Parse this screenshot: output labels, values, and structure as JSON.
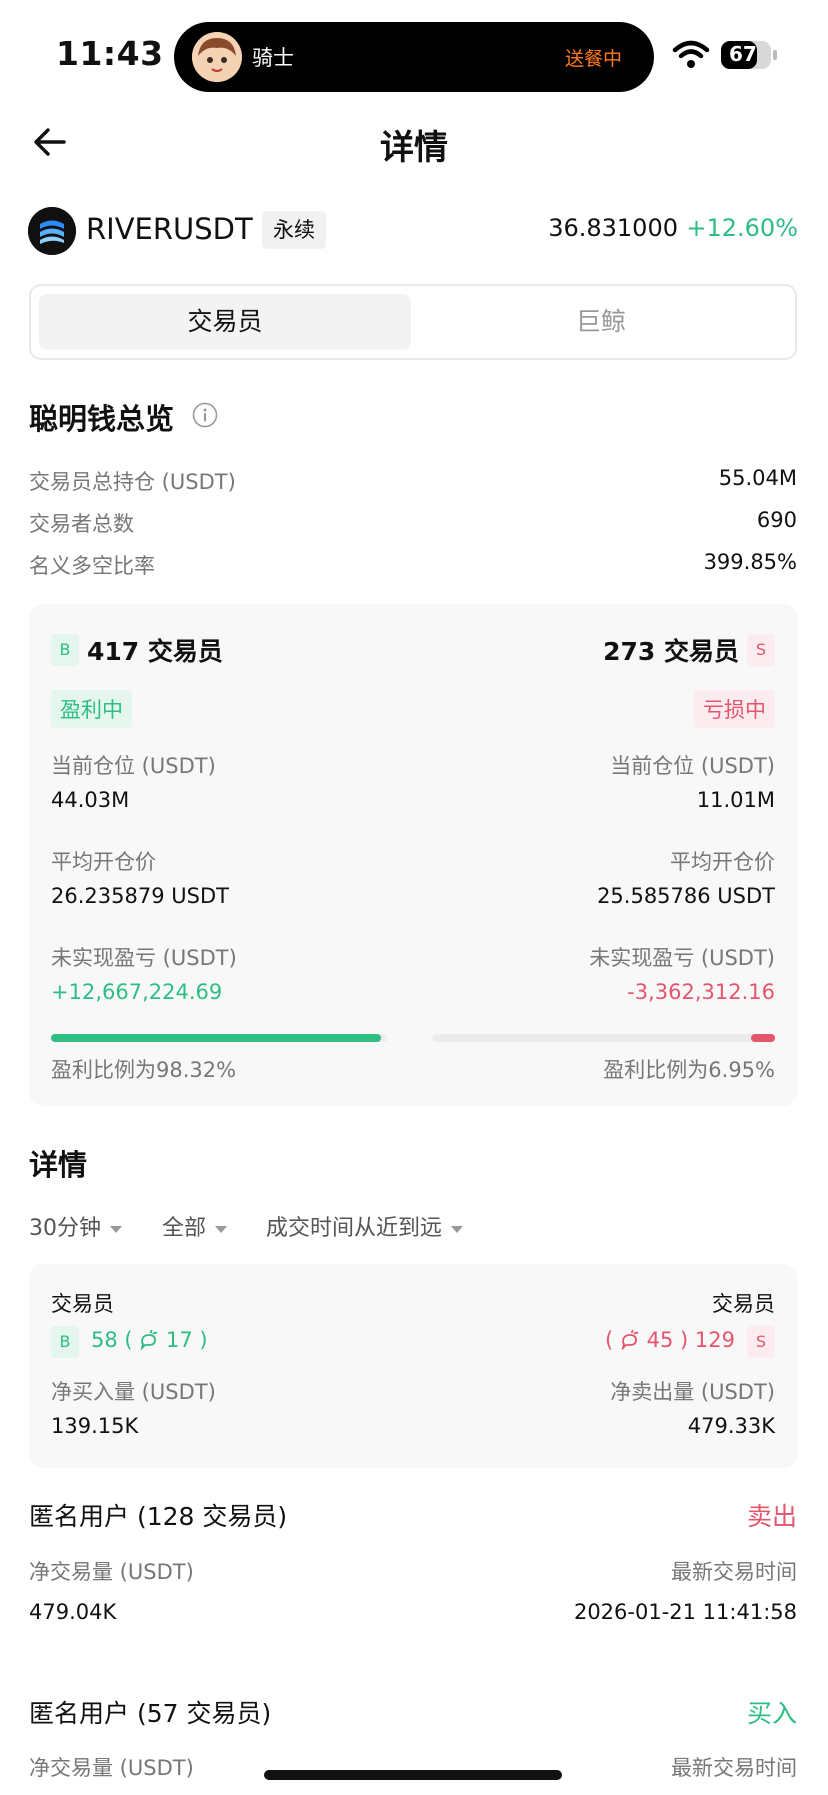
{
  "status_bar": {
    "time": "11:43",
    "island_name": "骑士",
    "island_status": "送餐中",
    "battery": "67"
  },
  "header": {
    "title": "详情"
  },
  "ticker": {
    "symbol": "RIVERUSDT",
    "badge": "永续",
    "price": "36.831000",
    "change": "+12.60%"
  },
  "tabs": [
    {
      "label": "交易员",
      "active": true
    },
    {
      "label": "巨鲸",
      "active": false
    }
  ],
  "overview": {
    "title": "聪明钱总览",
    "rows": [
      {
        "label": "交易员总持仓 (USDT)",
        "value": "55.04M"
      },
      {
        "label": "交易者总数",
        "value": "690"
      },
      {
        "label": "名义多空比率",
        "value": "399.85%"
      }
    ]
  },
  "long_side": {
    "badge": "B",
    "count": "417 交易员",
    "status": "盈利中",
    "position_label": "当前仓位 (USDT)",
    "position_value": "44.03M",
    "avg_label": "平均开仓价",
    "avg_value": "26.235879 USDT",
    "pnl_label": "未实现盈亏 (USDT)",
    "pnl_value": "+12,667,224.69",
    "profit_ratio": 0.9832,
    "profit_text": "盈利比例为98.32%"
  },
  "short_side": {
    "badge": "S",
    "count": "273 交易员",
    "status": "亏损中",
    "position_label": "当前仓位 (USDT)",
    "position_value": "11.01M",
    "avg_label": "平均开仓价",
    "avg_value": "25.585786 USDT",
    "pnl_label": "未实现盈亏 (USDT)",
    "pnl_value": "-3,362,312.16",
    "profit_ratio": 0.0695,
    "profit_text": "盈利比例为6.95%"
  },
  "details": {
    "title": "详情",
    "filters": [
      "30分钟",
      "全部",
      "成交时间从近到远"
    ],
    "summary": {
      "left_title": "交易员",
      "right_title": "交易员",
      "buy_badge": "B",
      "buy_count": "58",
      "buy_whale": "17",
      "sell_badge": "S",
      "sell_count": "129",
      "sell_whale": "45",
      "net_buy_label": "净买入量 (USDT)",
      "net_buy_value": "139.15K",
      "net_sell_label": "净卖出量 (USDT)",
      "net_sell_value": "479.33K"
    },
    "entries": [
      {
        "name": "匿名用户 (128 交易员)",
        "action": "卖出",
        "action_color": "#e3566d",
        "volume_label": "净交易量 (USDT)",
        "volume_value": "479.04K",
        "time_label": "最新交易时间",
        "time_value": "2026-01-21 11:41:58"
      },
      {
        "name": "匿名用户 (57 交易员)",
        "action": "买入",
        "action_color": "#2ebd85",
        "volume_label": "净交易量 (USDT)",
        "time_label": "最新交易时间"
      }
    ]
  },
  "colors": {
    "green": "#2ebd85",
    "red": "#e3566d",
    "accent_orange": "#ff7a1a"
  }
}
